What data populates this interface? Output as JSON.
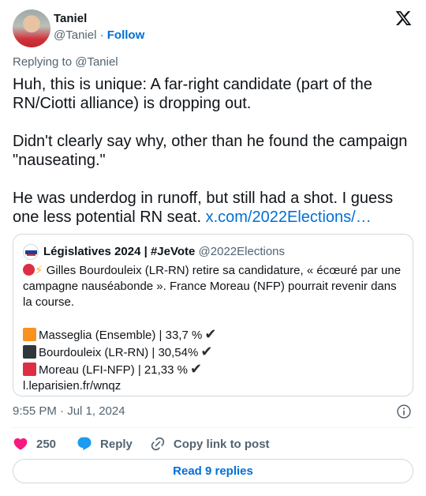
{
  "author": {
    "name": "Taniel",
    "handle": "@Taniel",
    "separator": "·",
    "follow_label": "Follow"
  },
  "reply_context": "Replying to @Taniel",
  "tweet": {
    "paragraph_1": "Huh, this is unique: A far-right candidate (part of the RN/Ciotti alliance) is dropping out.",
    "paragraph_2": "Didn't clearly say why, other than he found the campaign \"nauseating.\"",
    "paragraph_3": "He was underdog in runoff, but still had a shot. I guess one less potential RN seat.",
    "link": "x.com/2022Elections/…"
  },
  "quote": {
    "name": "Législatives 2024 | #JeVote",
    "handle": "@2022Elections",
    "lead_text": "Gilles Bourdouleix (LR-RN) retire sa candidature, « écœuré par une campagne nauséabonde ». France Moreau (NFP) pourrait revenir dans la course.",
    "results": [
      {
        "label": "Masseglia (Ensemble) | 33,7 %",
        "color": "#f7931e"
      },
      {
        "label": "Bourdouleix (LR-RN) | 30,54%",
        "color": "#31373d"
      },
      {
        "label": "Moreau (LFI-NFP) | 21,33 %",
        "color": "#dd2e44"
      }
    ],
    "check_glyph": "✔",
    "source_link": "l.leparisien.fr/wnqz"
  },
  "timestamp": "9:55 PM · Jul 1, 2024",
  "actions": {
    "like_count": "250",
    "reply_label": "Reply",
    "copy_label": "Copy link to post"
  },
  "read_replies_label": "Read 9 replies",
  "colors": {
    "accent": "#006fd6",
    "like": "#f91880",
    "reply_icon": "#1d9bf0",
    "muted": "#536471",
    "border": "#cfd9de"
  }
}
